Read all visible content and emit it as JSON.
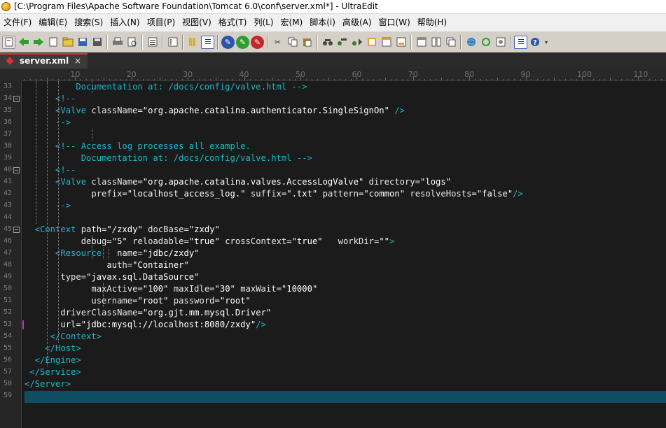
{
  "window": {
    "title": "[C:\\Program Files\\Apache Software Foundation\\Tomcat 6.0\\conf\\server.xml*] - UltraEdit"
  },
  "menu": [
    "文件(F)",
    "编辑(E)",
    "搜索(S)",
    "插入(N)",
    "项目(P)",
    "视图(V)",
    "格式(T)",
    "列(L)",
    "宏(M)",
    "脚本(i)",
    "高级(A)",
    "窗口(W)",
    "帮助(H)"
  ],
  "toolbar_icons": [
    "new-file-icon",
    "open-icon",
    "back-icon",
    "forward-icon",
    "new-doc-icon",
    "open-folder-icon",
    "save-icon",
    "save-all-icon",
    "print-icon",
    "print-preview-icon",
    "list-icon",
    "find-in-files-icon",
    "columns-icon",
    "show-spaces-icon",
    "hex-icon",
    "ftp-icon",
    "convert-icon",
    "cut-icon",
    "copy-icon",
    "paste-icon",
    "find-icon",
    "replace-icon",
    "find-next-icon",
    "tag-list-icon",
    "function-list-icon",
    "output-icon",
    "window-icon",
    "tile-icon",
    "cascade-icon",
    "web-icon",
    "refresh-icon",
    "settings-icon",
    "script-icon",
    "help-icon"
  ],
  "tab": {
    "label": "server.xml",
    "close": "×"
  },
  "ruler": [
    "10",
    "20",
    "30",
    "40",
    "50",
    "60",
    "70",
    "80",
    "90",
    "100",
    "110"
  ],
  "editor": {
    "lines": [
      {
        "num": "33",
        "segs": [
          [
            "c",
            "          Documentation at: /docs/config/valve.html -->"
          ]
        ]
      },
      {
        "num": "34",
        "segs": [
          [
            "c",
            "      <!--"
          ]
        ]
      },
      {
        "num": "35",
        "segs": [
          [
            "t",
            "      <Valve "
          ],
          [
            "a",
            "className"
          ],
          [
            "e",
            "="
          ],
          [
            "v",
            "\"org.apache.catalina.authenticator.SingleSignOn\""
          ],
          [
            "t",
            " />"
          ]
        ]
      },
      {
        "num": "36",
        "segs": [
          [
            "c",
            "      -->"
          ]
        ]
      },
      {
        "num": "37",
        "segs": [
          [
            "ws",
            ""
          ]
        ]
      },
      {
        "num": "38",
        "segs": [
          [
            "c",
            "      <!-- Access log processes all example."
          ]
        ]
      },
      {
        "num": "39",
        "segs": [
          [
            "c",
            "           Documentation at: /docs/config/valve.html -->"
          ]
        ]
      },
      {
        "num": "40",
        "segs": [
          [
            "c",
            "      <!--"
          ]
        ]
      },
      {
        "num": "41",
        "segs": [
          [
            "t",
            "      <Valve "
          ],
          [
            "a",
            "className"
          ],
          [
            "e",
            "="
          ],
          [
            "v",
            "\"org.apache.catalina.valves.AccessLogValve\""
          ],
          [
            "a",
            " directory"
          ],
          [
            "e",
            "="
          ],
          [
            "v",
            "\"logs\""
          ]
        ]
      },
      {
        "num": "42",
        "segs": [
          [
            "a",
            "             prefix"
          ],
          [
            "e",
            "="
          ],
          [
            "v",
            "\"localhost_access_log.\""
          ],
          [
            "a",
            " suffix"
          ],
          [
            "e",
            "="
          ],
          [
            "v",
            "\".txt\""
          ],
          [
            "a",
            " pattern"
          ],
          [
            "e",
            "="
          ],
          [
            "v",
            "\"common\""
          ],
          [
            "a",
            " resolveHosts"
          ],
          [
            "e",
            "="
          ],
          [
            "v",
            "\"false\""
          ],
          [
            "t",
            "/>"
          ]
        ]
      },
      {
        "num": "43",
        "segs": [
          [
            "c",
            "      -->"
          ]
        ]
      },
      {
        "num": "44",
        "segs": [
          [
            "ws",
            ""
          ]
        ]
      },
      {
        "num": "45",
        "segs": [
          [
            "t",
            "  <Context "
          ],
          [
            "a",
            "path"
          ],
          [
            "e",
            "="
          ],
          [
            "v",
            "\"/zxdy\""
          ],
          [
            "a",
            " docBase"
          ],
          [
            "e",
            "="
          ],
          [
            "v",
            "\"zxdy\""
          ]
        ]
      },
      {
        "num": "46",
        "segs": [
          [
            "a",
            "           debug"
          ],
          [
            "e",
            "="
          ],
          [
            "v",
            "\"5\""
          ],
          [
            "a",
            " reloadable"
          ],
          [
            "e",
            "="
          ],
          [
            "v",
            "\"true\""
          ],
          [
            "a",
            " crossContext"
          ],
          [
            "e",
            "="
          ],
          [
            "v",
            "\"true\""
          ],
          [
            "a",
            "   workDir"
          ],
          [
            "e",
            "="
          ],
          [
            "v",
            "\"\""
          ],
          [
            "t",
            ">"
          ]
        ]
      },
      {
        "num": "47",
        "segs": [
          [
            "t",
            "      <Resource"
          ],
          [
            "a",
            "   name"
          ],
          [
            "e",
            "="
          ],
          [
            "v",
            "\"jdbc/zxdy\""
          ]
        ]
      },
      {
        "num": "48",
        "segs": [
          [
            "a",
            "                auth"
          ],
          [
            "e",
            "="
          ],
          [
            "v",
            "\"Container\""
          ]
        ]
      },
      {
        "num": "49",
        "segs": [
          [
            "a",
            "       type"
          ],
          [
            "e",
            "="
          ],
          [
            "v",
            "\"javax.sql.DataSource\""
          ]
        ]
      },
      {
        "num": "50",
        "segs": [
          [
            "a",
            "             maxActive"
          ],
          [
            "e",
            "="
          ],
          [
            "v",
            "\"100\""
          ],
          [
            "a",
            " maxIdle"
          ],
          [
            "e",
            "="
          ],
          [
            "v",
            "\"30\""
          ],
          [
            "a",
            " maxWait"
          ],
          [
            "e",
            "="
          ],
          [
            "v",
            "\"10000\""
          ]
        ]
      },
      {
        "num": "51",
        "segs": [
          [
            "a",
            "             username"
          ],
          [
            "e",
            "="
          ],
          [
            "v",
            "\"root\""
          ],
          [
            "a",
            " password"
          ],
          [
            "e",
            "="
          ],
          [
            "v",
            "\"root\""
          ]
        ]
      },
      {
        "num": "52",
        "segs": [
          [
            "a",
            "       driverClassName"
          ],
          [
            "e",
            "="
          ],
          [
            "v",
            "\"org.gjt.mm.mysql.Driver\""
          ]
        ]
      },
      {
        "num": "53",
        "segs": [
          [
            "a",
            "       url"
          ],
          [
            "e",
            "="
          ],
          [
            "v",
            "\"jdbc:mysql://localhost:8080/zxdy\""
          ],
          [
            "t",
            "/>"
          ]
        ]
      },
      {
        "num": "54",
        "segs": [
          [
            "t",
            "     </Context>"
          ]
        ]
      },
      {
        "num": "55",
        "segs": [
          [
            "t",
            "    </Host>"
          ]
        ]
      },
      {
        "num": "56",
        "segs": [
          [
            "t",
            "  </Engine>"
          ]
        ]
      },
      {
        "num": "57",
        "segs": [
          [
            "t",
            " </Service>"
          ]
        ]
      },
      {
        "num": "58",
        "segs": [
          [
            "t",
            "</Server>"
          ]
        ]
      },
      {
        "num": "59",
        "segs": [
          [
            "ws",
            ""
          ]
        ]
      }
    ]
  },
  "colors": {
    "tag": "#1fb6c9",
    "attr": "#e8e8e8",
    "value": "#ffffff",
    "current_line": "#0d4e63",
    "tab_accent": "#d6303a"
  }
}
